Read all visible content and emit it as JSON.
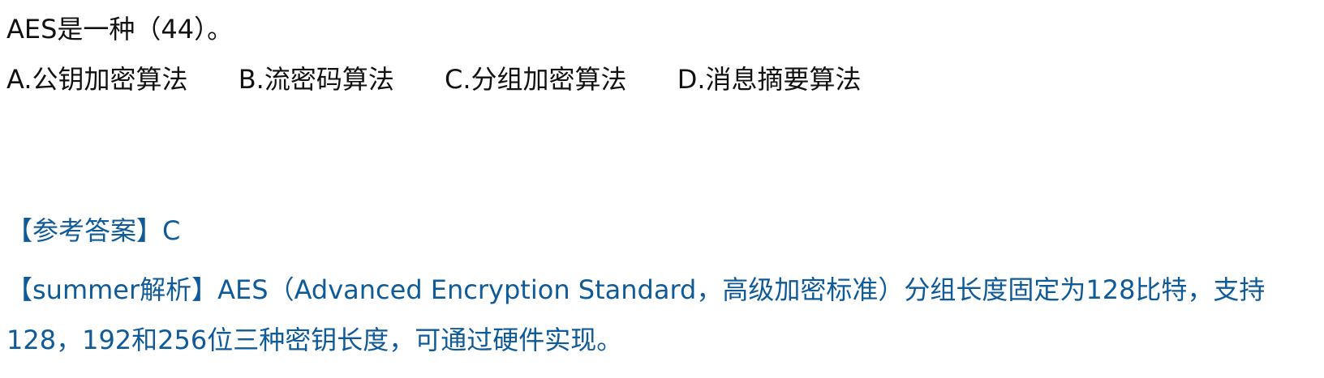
{
  "question": "AES是一种（44）。",
  "options": [
    "A.公钥加密算法",
    "B.流密码算法",
    "C.分组加密算法",
    "D.消息摘要算法"
  ],
  "answer": "【参考答案】C",
  "explanation": "【summer解析】AES（Advanced Encryption Standard，高级加密标准）分组长度固定为128比特，支持128，192和256位三种密钥长度，可通过硬件实现。",
  "colors": {
    "text": "#111111",
    "accent": "#0f5a98"
  }
}
